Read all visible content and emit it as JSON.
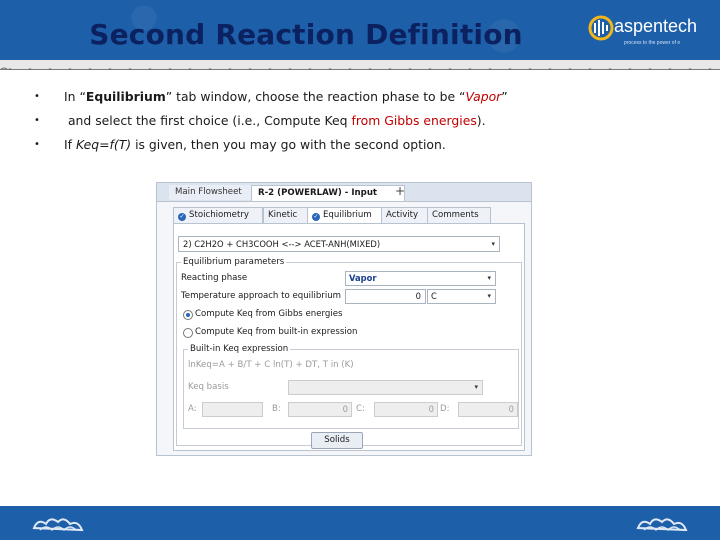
{
  "slide": {
    "title": "Second Reaction Definition",
    "logo_text": "aspentech",
    "logo_tagline": "process   to the power of e"
  },
  "bullets": [
    {
      "before": "In “",
      "bold": "Equilibrium",
      "after": "” tab window, choose the reaction phase to be “",
      "red_italic": "Vapor",
      "end": "”"
    },
    {
      "before": " and select the first choice (i.e., Compute Keq ",
      "red": "from Gibbs energies",
      "end": ")."
    },
    {
      "before": "If ",
      "italic": "Keq=f(T)",
      "end": " is given, then you may go with the second option."
    }
  ],
  "window": {
    "doc_tabs": [
      "Main Flowsheet",
      "R-2 (POWERLAW) - Input"
    ],
    "add_tab_symbol": "+",
    "subtabs": [
      "Stoichiometry",
      "Kinetic",
      "Equilibrium",
      "Activity",
      "Comments"
    ],
    "active_subtab": "Equilibrium",
    "reaction": "2) C2H2O + CH3COOH  <-->  ACET-ANH(MIXED)",
    "params_legend": "Equilibrium parameters",
    "reacting_phase_label": "Reacting phase",
    "reacting_phase_value": "Vapor",
    "temp_approach_label": "Temperature approach to equilibrium",
    "temp_approach_value": "0",
    "temp_unit": "C",
    "option_gibbs": "Compute Keq from Gibbs energies",
    "option_builtin": "Compute Keq from built-in expression",
    "builtin_legend": "Built-in Keq expression",
    "keq_formula": "lnKeq=A + B/T + C ln(T) + DT, T in (K)",
    "keq_basis_label": "Keq basis",
    "coeffs": [
      {
        "label": "A:",
        "value": ""
      },
      {
        "label": "B:",
        "value": "0"
      },
      {
        "label": "C:",
        "value": "0"
      },
      {
        "label": "D:",
        "value": "0"
      }
    ],
    "solids_button": "Solids"
  },
  "colors": {
    "header_blue": "#1d5fa8",
    "title_navy": "#0b2160",
    "highlight_red": "#c00000"
  }
}
